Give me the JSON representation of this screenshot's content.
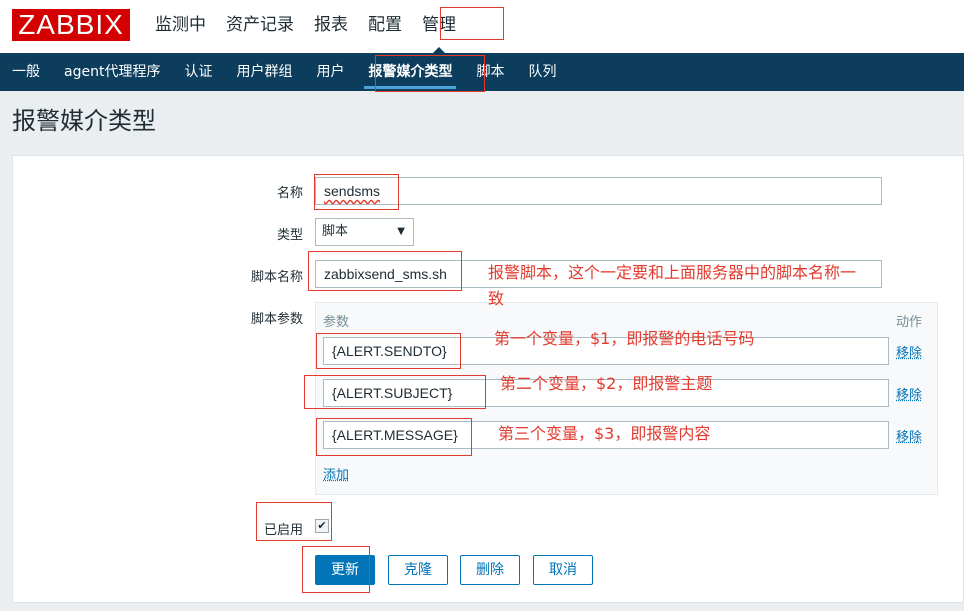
{
  "brand": {
    "logo_text": "ZABBIX",
    "color": "#d40000"
  },
  "topnav": [
    {
      "label": "监测中",
      "active": false
    },
    {
      "label": "资产记录",
      "active": false
    },
    {
      "label": "报表",
      "active": false
    },
    {
      "label": "配置",
      "active": false
    },
    {
      "label": "管理",
      "active": true
    }
  ],
  "subnav": [
    {
      "label": "一般",
      "active": false
    },
    {
      "label": "agent代理程序",
      "active": false
    },
    {
      "label": "认证",
      "active": false
    },
    {
      "label": "用户群组",
      "active": false
    },
    {
      "label": "用户",
      "active": false
    },
    {
      "label": "报警媒介类型",
      "active": true
    },
    {
      "label": "脚本",
      "active": false
    },
    {
      "label": "队列",
      "active": false
    }
  ],
  "page_title": "报警媒介类型",
  "form": {
    "name_label": "名称",
    "name_value": "sendsms",
    "type_label": "类型",
    "type_value": "脚本",
    "script_name_label": "脚本名称",
    "script_name_value": "zabbixsend_sms.sh",
    "script_params_label": "脚本参数",
    "params_header": "参数",
    "actions_header": "动作",
    "params": [
      {
        "value": "{ALERT.SENDTO}",
        "remove_label": "移除"
      },
      {
        "value": "{ALERT.SUBJECT}",
        "remove_label": "移除"
      },
      {
        "value": "{ALERT.MESSAGE}",
        "remove_label": "移除"
      }
    ],
    "add_label": "添加",
    "enabled_label": "已启用",
    "enabled_checked": true
  },
  "buttons": {
    "update": "更新",
    "clone": "克隆",
    "delete": "删除",
    "cancel": "取消"
  },
  "annotations": {
    "script_note_line1": "报警脚本，这个一定要和上面服务器中的脚本名称一",
    "script_note_line2": "致",
    "param1_note": "第一个变量，$1，即报警的电话号码",
    "param2_note": "第二个变量，$2，即报警主题",
    "param3_note": "第三个变量，$3，即报警内容",
    "color": "#e23b2e"
  },
  "colors": {
    "nav_dark": "#0c3d5c",
    "accent": "#0275b8",
    "background": "#ebeef0"
  }
}
